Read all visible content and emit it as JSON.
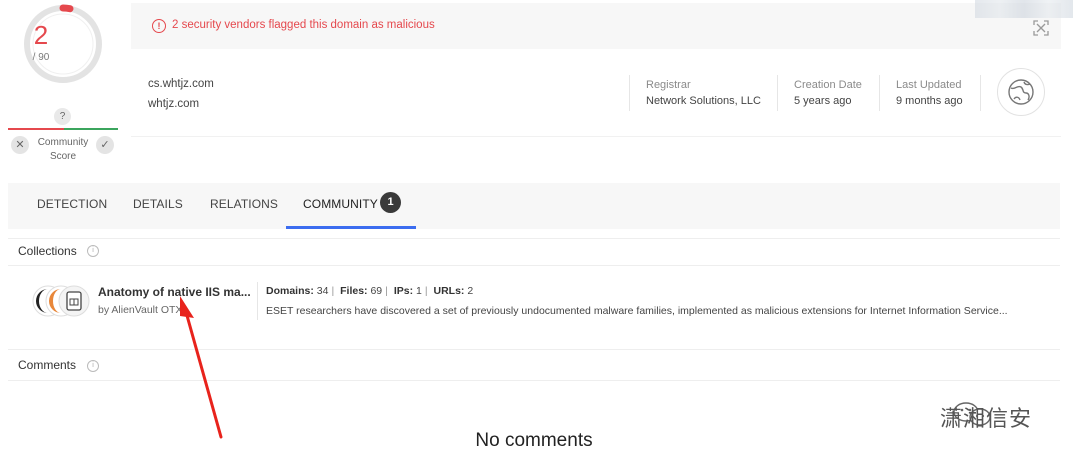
{
  "score": {
    "value": "2",
    "denominator": "/ 90",
    "help": "?"
  },
  "community_score": {
    "label_line1": "Community",
    "label_line2": "Score",
    "vote_down": "✕",
    "vote_up": "✓"
  },
  "alert": {
    "text": "2 security vendors flagged this domain as malicious",
    "icon": "!"
  },
  "domains": [
    "cs.whtjz.com",
    "whtjz.com"
  ],
  "meta": {
    "registrar": {
      "label": "Registrar",
      "value": "Network Solutions, LLC"
    },
    "creation": {
      "label": "Creation Date",
      "value": "5 years ago"
    },
    "updated": {
      "label": "Last Updated",
      "value": "9 months ago"
    }
  },
  "tabs": [
    {
      "label": "DETECTION"
    },
    {
      "label": "DETAILS"
    },
    {
      "label": "RELATIONS"
    },
    {
      "label": "COMMUNITY",
      "badge": "1"
    }
  ],
  "collections": {
    "title": "Collections",
    "item": {
      "title": "Anatomy of native IIS ma...",
      "author": "by AlienVault OTX",
      "stats": [
        {
          "label": "Domains:",
          "value": "34"
        },
        {
          "label": "Files:",
          "value": "69"
        },
        {
          "label": "IPs:",
          "value": "1"
        },
        {
          "label": "URLs:",
          "value": "2"
        }
      ],
      "description": "ESET researchers have discovered a set of previously undocumented malware families, implemented as malicious extensions for Internet Information Service..."
    }
  },
  "comments": {
    "title": "Comments",
    "empty": "No comments"
  },
  "watermark": {
    "text": "潇湘信安"
  },
  "colors": {
    "malicious": "#e5484d",
    "harmless": "#3ba55d",
    "tab_accent": "#3c6df0",
    "annotation": "#e8231c"
  }
}
